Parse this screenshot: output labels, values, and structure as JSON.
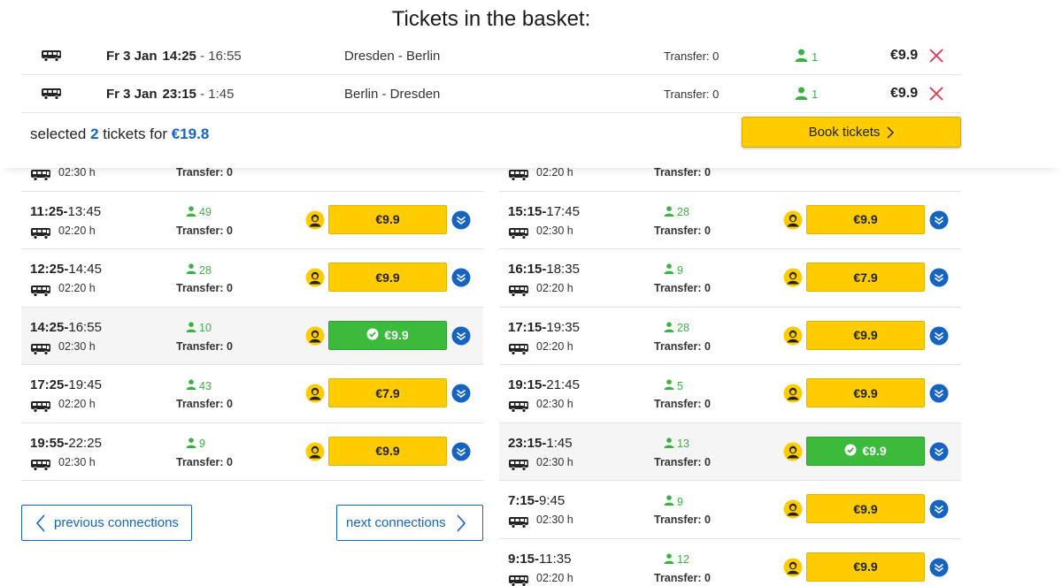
{
  "basket": {
    "title": "Tickets in the basket:",
    "tickets": [
      {
        "date": "Fr 3 Jan",
        "dep": "14:25",
        "arr": "- 16:55",
        "route": "Dresden - Berlin",
        "transfer": "Transfer: 0",
        "passengers": "1",
        "price": "€9.9"
      },
      {
        "date": "Fr 3 Jan",
        "dep": "23:15",
        "arr": "- 1:45",
        "route": "Berlin - Dresden",
        "transfer": "Transfer: 0",
        "passengers": "1",
        "price": "€9.9"
      }
    ],
    "summary": {
      "prefix": "selected",
      "count": "2",
      "middle": "tickets for",
      "total": "€19.8"
    },
    "book_label": "Book tickets"
  },
  "left_connections": [
    {
      "dep": "",
      "arr": "",
      "duration": "02:30 h",
      "seats": "",
      "transfer": "Transfer: 0",
      "price": "",
      "selected": false,
      "partial": true
    },
    {
      "dep": "11:25",
      "arr": "13:45",
      "duration": "02:20 h",
      "seats": "49",
      "transfer": "Transfer: 0",
      "price": "€9.9",
      "selected": false
    },
    {
      "dep": "12:25",
      "arr": "14:45",
      "duration": "02:20 h",
      "seats": "28",
      "transfer": "Transfer: 0",
      "price": "€9.9",
      "selected": false
    },
    {
      "dep": "14:25",
      "arr": "16:55",
      "duration": "02:30 h",
      "seats": "10",
      "transfer": "Transfer: 0",
      "price": "€9.9",
      "selected": true
    },
    {
      "dep": "17:25",
      "arr": "19:45",
      "duration": "02:20 h",
      "seats": "43",
      "transfer": "Transfer: 0",
      "price": "€7.9",
      "selected": false
    },
    {
      "dep": "19:55",
      "arr": "22:25",
      "duration": "02:30 h",
      "seats": "9",
      "transfer": "Transfer: 0",
      "price": "€9.9",
      "selected": false
    }
  ],
  "right_connections": [
    {
      "dep": "",
      "arr": "",
      "duration": "02:20 h",
      "seats": "",
      "transfer": "Transfer: 0",
      "price": "",
      "selected": false,
      "partial": true
    },
    {
      "dep": "15:15",
      "arr": "17:45",
      "duration": "02:30 h",
      "seats": "28",
      "transfer": "Transfer: 0",
      "price": "€9.9",
      "selected": false
    },
    {
      "dep": "16:15",
      "arr": "18:35",
      "duration": "02:20 h",
      "seats": "9",
      "transfer": "Transfer: 0",
      "price": "€7.9",
      "selected": false
    },
    {
      "dep": "17:15",
      "arr": "19:35",
      "duration": "02:20 h",
      "seats": "28",
      "transfer": "Transfer: 0",
      "price": "€9.9",
      "selected": false
    },
    {
      "dep": "19:15",
      "arr": "21:45",
      "duration": "02:30 h",
      "seats": "5",
      "transfer": "Transfer: 0",
      "price": "€9.9",
      "selected": false
    },
    {
      "dep": "23:15",
      "arr": "1:45",
      "duration": "02:30 h",
      "seats": "13",
      "transfer": "Transfer: 0",
      "price": "€9.9",
      "selected": true
    },
    {
      "dep": "7:15",
      "arr": "9:45",
      "duration": "02:30 h",
      "seats": "9",
      "transfer": "Transfer: 0",
      "price": "€9.9",
      "selected": false
    },
    {
      "dep": "9:15",
      "arr": "11:35",
      "duration": "02:20 h",
      "seats": "12",
      "transfer": "Transfer: 0",
      "price": "€9.9",
      "selected": false
    }
  ],
  "pagination": {
    "prev_label": "previous connections",
    "next_label": "next connections"
  },
  "icons": {
    "bus": "bus-icon",
    "person": "person-icon",
    "remove": "close-icon",
    "driver": "driver-avatar-icon",
    "expand": "chevron-down-icon",
    "check": "check-circle-icon"
  },
  "colors": {
    "accent_yellow": "#ffcc00",
    "selected_green": "#3cba3c",
    "link_blue": "#1565c0",
    "remove_red": "#e0334b",
    "seats_green": "#3cb043"
  }
}
